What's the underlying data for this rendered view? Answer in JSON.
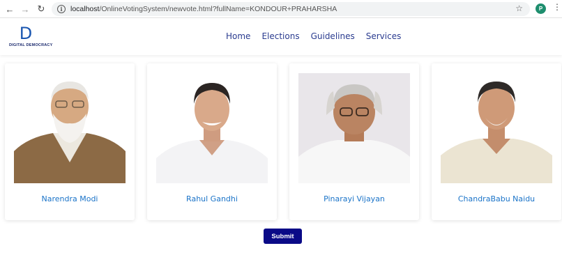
{
  "browser": {
    "url_host": "localhost",
    "url_path": "/OnlineVotingSystem/newvote.html?fullName=KONDOUR+PRAHARSHA",
    "profile_initial": "P"
  },
  "site": {
    "logo_letter": "D",
    "logo_text": "DIGITAL DEMOCRACY",
    "nav": [
      "Home",
      "Elections",
      "Guidelines",
      "Services"
    ]
  },
  "candidates": [
    {
      "name": "Narendra Modi"
    },
    {
      "name": "Rahul Gandhi"
    },
    {
      "name": "Pinarayi Vijayan"
    },
    {
      "name": "ChandraBabu Naidu"
    }
  ],
  "submit_label": "Submit",
  "colors": {
    "accent": "#1a73c8",
    "nav": "#2a3b8f",
    "submit_bg": "#0a0a87"
  }
}
